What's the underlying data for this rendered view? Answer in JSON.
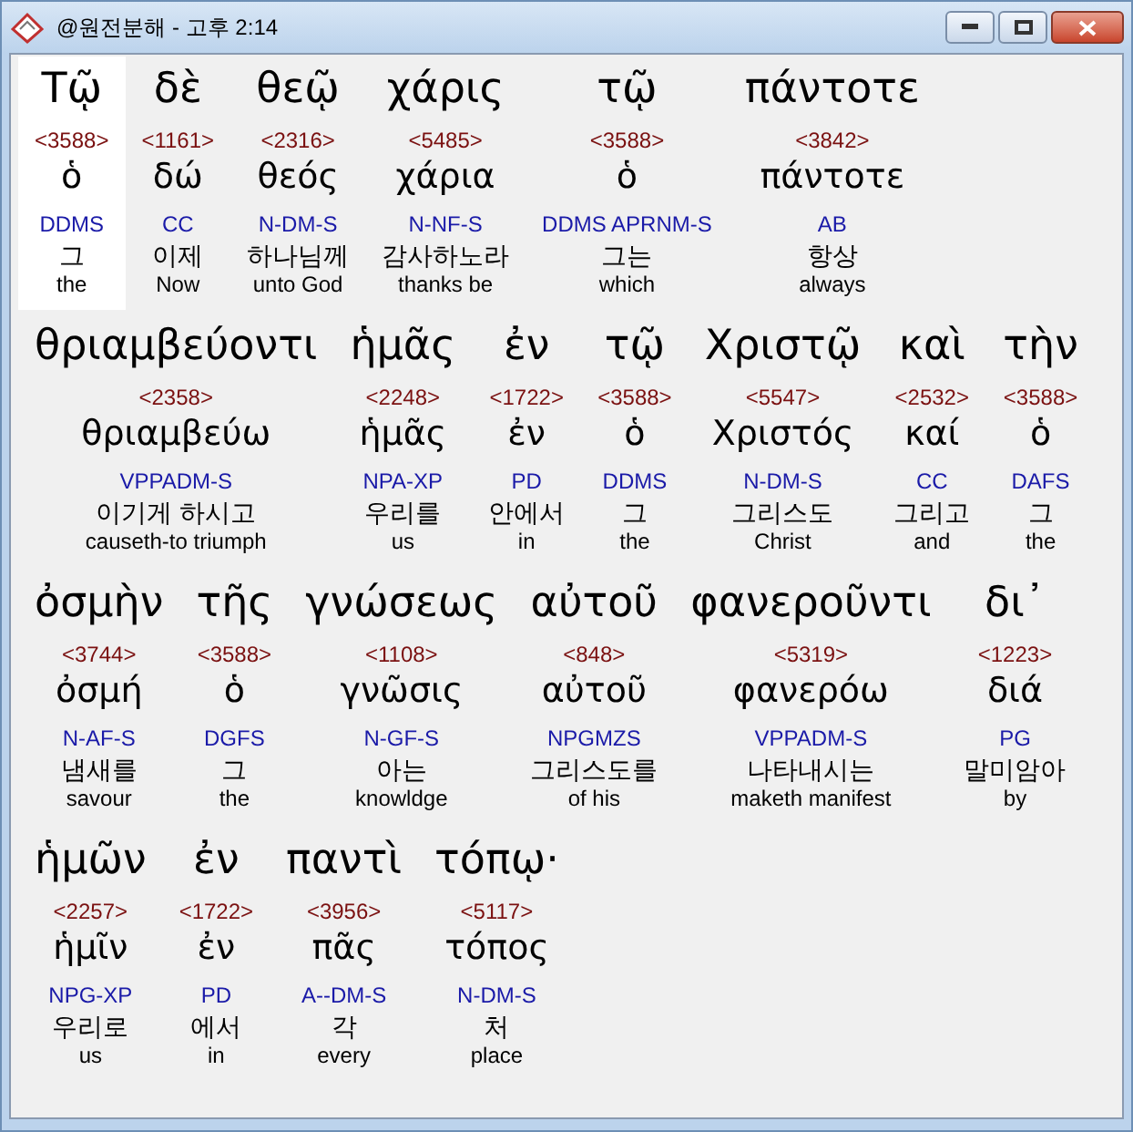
{
  "window": {
    "title": "@원전분해 - 고후 2:14"
  },
  "lines": [
    [
      {
        "greek": "Τῷ",
        "strong": "<3588>",
        "lemma": "ὁ",
        "parse": "DDMS",
        "korean": "그",
        "english": "the",
        "selected": true
      },
      {
        "greek": "δὲ",
        "strong": "<1161>",
        "lemma": "δώ",
        "parse": "CC",
        "korean": "이제",
        "english": "Now",
        "selected": false
      },
      {
        "greek": "θεῷ",
        "strong": "<2316>",
        "lemma": "θεός",
        "parse": "N-DM-S",
        "korean": "하나님께",
        "english": "unto God",
        "selected": false
      },
      {
        "greek": "χάρις",
        "strong": "<5485>",
        "lemma": "χάρια",
        "parse": "N-NF-S",
        "korean": "감사하노라",
        "english": "thanks be",
        "selected": false
      },
      {
        "greek": "τῷ",
        "strong": "<3588>",
        "lemma": "ὁ",
        "parse": "DDMS APRNM-S",
        "korean": "그는",
        "english": "which",
        "selected": false
      },
      {
        "greek": "πάντοτε",
        "strong": "<3842>",
        "lemma": "πάντοτε",
        "parse": "AB",
        "korean": "항상",
        "english": "always",
        "selected": false
      }
    ],
    [
      {
        "greek": "θριαμβεύοντι",
        "strong": "<2358>",
        "lemma": "θριαμβεύω",
        "parse": "VPPADM-S",
        "korean": "이기게 하시고",
        "english": "causeth-to triumph",
        "selected": false
      },
      {
        "greek": "ἡμᾶς",
        "strong": "<2248>",
        "lemma": "ἡμᾶς",
        "parse": "NPA-XP",
        "korean": "우리를",
        "english": "us",
        "selected": false
      },
      {
        "greek": "ἐν",
        "strong": "<1722>",
        "lemma": "ἐν",
        "parse": "PD",
        "korean": "안에서",
        "english": "in",
        "selected": false
      },
      {
        "greek": "τῷ",
        "strong": "<3588>",
        "lemma": "ὁ",
        "parse": "DDMS",
        "korean": "그",
        "english": "the",
        "selected": false
      },
      {
        "greek": "Χριστῷ",
        "strong": "<5547>",
        "lemma": "Χριστός",
        "parse": "N-DM-S",
        "korean": "그리스도",
        "english": "Christ",
        "selected": false
      },
      {
        "greek": "καὶ",
        "strong": "<2532>",
        "lemma": "καί",
        "parse": "CC",
        "korean": "그리고",
        "english": "and",
        "selected": false
      },
      {
        "greek": "τὴν",
        "strong": "<3588>",
        "lemma": "ὁ",
        "parse": "DAFS",
        "korean": "그",
        "english": "the",
        "selected": false
      }
    ],
    [
      {
        "greek": "ὀσμὴν",
        "strong": "<3744>",
        "lemma": "ὀσμή",
        "parse": "N-AF-S",
        "korean": "냄새를",
        "english": "savour",
        "selected": false
      },
      {
        "greek": "τῆς",
        "strong": "<3588>",
        "lemma": "ὁ",
        "parse": "DGFS",
        "korean": "그",
        "english": "the",
        "selected": false
      },
      {
        "greek": "γνώσεως",
        "strong": "<1108>",
        "lemma": "γνῶσις",
        "parse": "N-GF-S",
        "korean": "아는",
        "english": "knowldge",
        "selected": false
      },
      {
        "greek": "αὐτοῦ",
        "strong": "<848>",
        "lemma": "αὐτοῦ",
        "parse": "NPGMZS",
        "korean": "그리스도를",
        "english": "of his",
        "selected": false
      },
      {
        "greek": "φανεροῦντι",
        "strong": "<5319>",
        "lemma": "φανερόω",
        "parse": "VPPADM-S",
        "korean": "나타내시는",
        "english": "maketh manifest",
        "selected": false
      },
      {
        "greek": "δι᾽",
        "strong": "<1223>",
        "lemma": "διά",
        "parse": "PG",
        "korean": "말미암아",
        "english": "by",
        "selected": false
      }
    ],
    [
      {
        "greek": "ἡμῶν",
        "strong": "<2257>",
        "lemma": "ἡμῖν",
        "parse": "NPG-XP",
        "korean": "우리로",
        "english": "us",
        "selected": false
      },
      {
        "greek": "ἐν",
        "strong": "<1722>",
        "lemma": "ἐν",
        "parse": "PD",
        "korean": "에서",
        "english": "in",
        "selected": false
      },
      {
        "greek": "παντὶ",
        "strong": "<3956>",
        "lemma": "πᾶς",
        "parse": "A--DM-S",
        "korean": "각",
        "english": "every",
        "selected": false
      },
      {
        "greek": "τόπῳ·",
        "strong": "<5117>",
        "lemma": "τόπος",
        "parse": "N-DM-S",
        "korean": "처",
        "english": "place",
        "selected": false
      }
    ]
  ]
}
